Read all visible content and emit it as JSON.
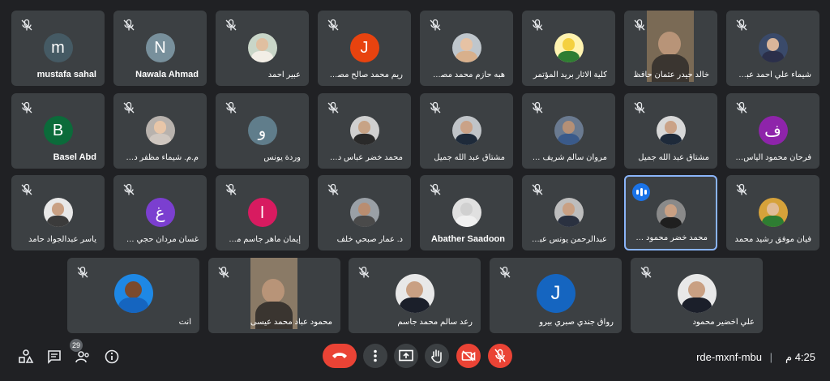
{
  "tiles": [
    {
      "name": "mustafa sahal",
      "letter": "m",
      "color": "#455a64",
      "kind": "letter",
      "dir": "ltr"
    },
    {
      "name": "Nawala Ahmad",
      "letter": "N",
      "color": "#78909c",
      "kind": "letter",
      "dir": "ltr"
    },
    {
      "name": "عبير احمد",
      "kind": "photo",
      "face": "#e0bfa0",
      "body": "#f2eee6",
      "bg": "#c9d6c8"
    },
    {
      "name": "ريم محمد صالح مصطفى",
      "letter": "J",
      "color": "#e8430f",
      "kind": "letter"
    },
    {
      "name": "هبه حازم محمد مصطفى",
      "kind": "photo",
      "face": "#e6c2a4",
      "body": "#d8b08c",
      "bg": "#bfc6cc"
    },
    {
      "name": "كلية الاثار بريد المؤتمر",
      "kind": "photo",
      "face": "#f4d03f",
      "body": "#2e7d32",
      "bg": "#fff3b0"
    },
    {
      "name": "خالد حيدر عثمان حافظ",
      "kind": "video",
      "bg": "#7a6a55"
    },
    {
      "name": "شيماء علي أحمد عبدالرزاق",
      "kind": "photo",
      "face": "#d9b59a",
      "body": "#2b2f4a",
      "bg": "#3a4a6a"
    },
    {
      "name": "Basel Abd",
      "letter": "B",
      "color": "#0b6b3a",
      "kind": "letter",
      "dir": "ltr"
    },
    {
      "name": "م.م. شيماء مظفر دخيل ي...",
      "kind": "photo",
      "face": "#e8c6a8",
      "body": "#cfc7c0",
      "bg": "#b8b2ad"
    },
    {
      "name": "وردة يونس",
      "letter": "و",
      "color": "#607d8b",
      "kind": "letter"
    },
    {
      "name": "محمد خضر عباس دهش",
      "kind": "photo",
      "face": "#c7a386",
      "body": "#2a2a2a",
      "bg": "#d0d0d0"
    },
    {
      "name": "مشتاق عبد الله جميل",
      "kind": "photo",
      "face": "#caa287",
      "body": "#1e2a3a",
      "bg": "#c0c4c8"
    },
    {
      "name": "مروان سالم شريف عبدالغ...",
      "kind": "photo",
      "face": "#b59076",
      "body": "#3a5a8a",
      "bg": "#6a7a90"
    },
    {
      "name": "مشتاق عبد الله جميل",
      "kind": "photo",
      "face": "#caa287",
      "body": "#1e2a3a",
      "bg": "#d8d8d8"
    },
    {
      "name": "فرحان محمود الياس حوار",
      "letter": "ف",
      "color": "#8e24aa",
      "kind": "letter"
    },
    {
      "name": "ياسر عبدالجواد حامد",
      "kind": "photo",
      "face": "#c9a083",
      "body": "#3b3b3b",
      "bg": "#e8e8e8"
    },
    {
      "name": "غسان مردان حجي خضر",
      "letter": "غ",
      "color": "#7b3fd0",
      "kind": "letter"
    },
    {
      "name": "إيمان ماهر جاسم محمد",
      "letter": "ا",
      "color": "#d81b60",
      "kind": "letter"
    },
    {
      "name": "د. عمار صبحي خلف",
      "kind": "photo",
      "face": "#b98d70",
      "body": "#4a4a4a",
      "bg": "#9aa0a6"
    },
    {
      "name": "Abather Saadoon",
      "kind": "photo",
      "face": "#d0d0d0",
      "body": "#f0f0f0",
      "bg": "#e0e0e0",
      "dir": "ltr"
    },
    {
      "name": "عبدالرحمن يونس عبدالر...",
      "kind": "photo",
      "face": "#c9a083",
      "body": "#2a3140",
      "bg": "#bdbdbd"
    },
    {
      "name": "محمد خضر محمود عبو",
      "kind": "photo",
      "face": "#c9a083",
      "body": "#1f1f1f",
      "bg": "#8a8a8a",
      "active": true
    },
    {
      "name": "فيان موفق رشيد محمد",
      "kind": "photo",
      "face": "#e0bc97",
      "body": "#2e7d32",
      "bg": "#d6a23a"
    },
    {
      "name": "أنت",
      "kind": "photo",
      "face": "#7a4a2e",
      "body": "#1565c0",
      "bg": "#1e88e5"
    },
    {
      "name": "محمود عباد محمد عيسى",
      "kind": "video",
      "bg": "#8a7a66"
    },
    {
      "name": "رعد سالم محمد جاسم",
      "kind": "photo",
      "face": "#c9a083",
      "body": "#1b1f2a",
      "bg": "#e8e8e8"
    },
    {
      "name": "رواق جندي صبري بيرو",
      "letter": "J",
      "color": "#1565c0",
      "kind": "letter"
    },
    {
      "name": "علي أخضير محمود",
      "kind": "photo",
      "face": "#c9a083",
      "body": "#1b1f2a",
      "bg": "#e8e8e8"
    }
  ],
  "meeting": {
    "code": "rde-mxnf-mbu",
    "time": "4:25 م",
    "separator": "|"
  },
  "people_count": "29",
  "colors": {
    "end_call": "#ea4335",
    "muted": "#ea4335",
    "surface": "#3c4043",
    "active": "#8ab4f8"
  }
}
